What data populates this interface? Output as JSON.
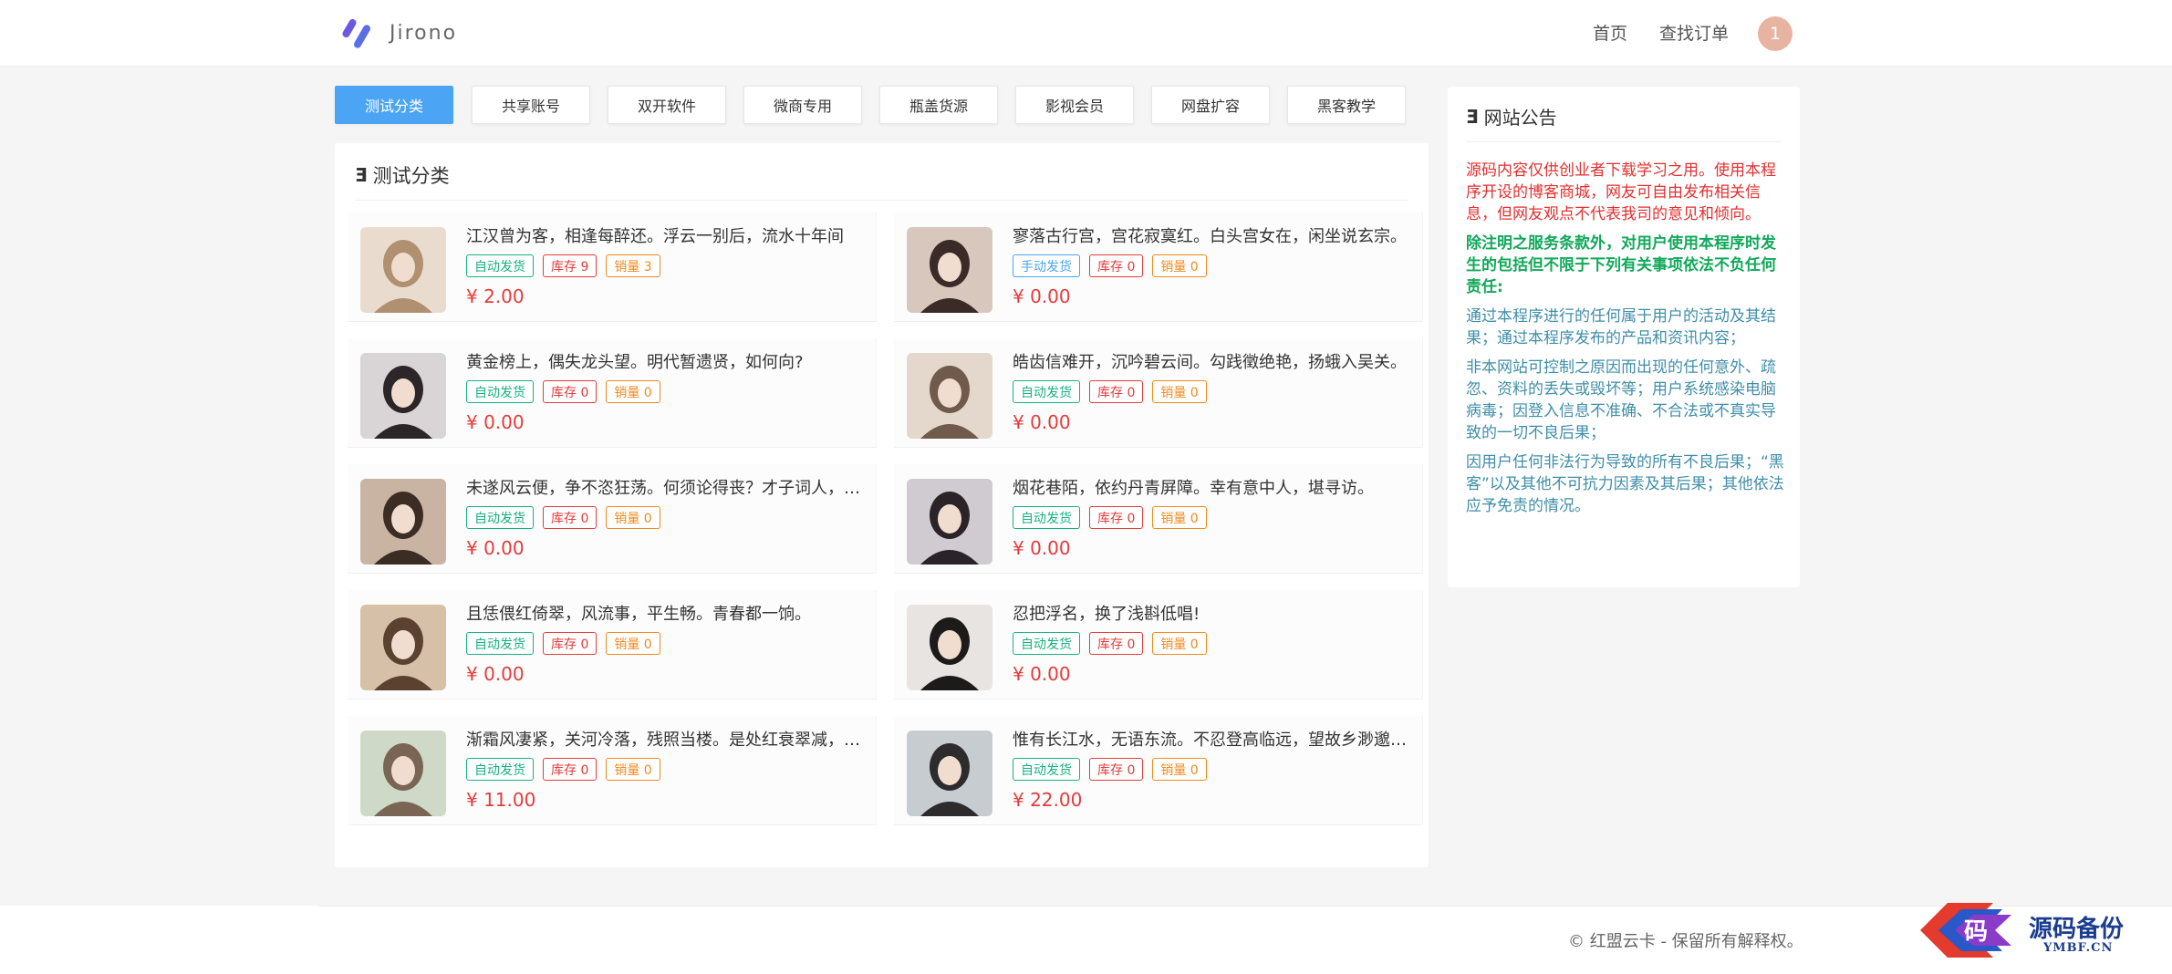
{
  "header": {
    "logo_text": "Jirono",
    "nav": {
      "home": "首页",
      "orders": "查找订单"
    },
    "badge_count": "1"
  },
  "tabs": [
    "测试分类",
    "共享账号",
    "双开软件",
    "微商专用",
    "瓶盖货源",
    "影视会员",
    "网盘扩容",
    "黑客教学"
  ],
  "active_tab": 0,
  "panel": {
    "title": "测试分类",
    "title_icon": "ellipsis-icon"
  },
  "products": [
    {
      "title": "江汉曾为客，相逢每醉还。浮云一别后，流水十年间",
      "delivery": "自动发货",
      "delivery_type": "auto",
      "stock": "库存 9",
      "sales": "销量 3",
      "price": "¥ 2.00"
    },
    {
      "title": "寥落古行宫，宫花寂寞红。白头宫女在，闲坐说玄宗。",
      "delivery": "手动发货",
      "delivery_type": "manual",
      "stock": "库存 0",
      "sales": "销量 0",
      "price": "¥ 0.00"
    },
    {
      "title": "黄金榜上，偶失龙头望。明代暂遗贤，如何向?",
      "delivery": "自动发货",
      "delivery_type": "auto",
      "stock": "库存 0",
      "sales": "销量 0",
      "price": "¥ 0.00"
    },
    {
      "title": "皓齿信难开，沉吟碧云间。勾践徵绝艳，扬蛾入吴关。",
      "delivery": "自动发货",
      "delivery_type": "auto",
      "stock": "库存 0",
      "sales": "销量 0",
      "price": "¥ 0.00"
    },
    {
      "title": "未遂风云便，争不恣狂荡。何须论得丧？才子词人，自是白衣卿相。",
      "delivery": "自动发货",
      "delivery_type": "auto",
      "stock": "库存 0",
      "sales": "销量 0",
      "price": "¥ 0.00"
    },
    {
      "title": "烟花巷陌，依约丹青屏障。幸有意中人，堪寻访。",
      "delivery": "自动发货",
      "delivery_type": "auto",
      "stock": "库存 0",
      "sales": "销量 0",
      "price": "¥ 0.00"
    },
    {
      "title": "且恁偎红倚翠，风流事，平生畅。青春都一饷。",
      "delivery": "自动发货",
      "delivery_type": "auto",
      "stock": "库存 0",
      "sales": "销量 0",
      "price": "¥ 0.00"
    },
    {
      "title": "忍把浮名，换了浅斟低唱!",
      "delivery": "自动发货",
      "delivery_type": "auto",
      "stock": "库存 0",
      "sales": "销量 0",
      "price": "¥ 0.00"
    },
    {
      "title": "渐霜风凄紧，关河冷落，残照当楼。是处红衰翠减，苒苒物华休。",
      "delivery": "自动发货",
      "delivery_type": "auto",
      "stock": "库存 0",
      "sales": "销量 0",
      "price": "¥ 11.00"
    },
    {
      "title": "惟有长江水，无语东流。不忍登高临远，望故乡渺邈，归思难收。",
      "delivery": "自动发货",
      "delivery_type": "auto",
      "stock": "库存 0",
      "sales": "销量 0",
      "price": "¥ 22.00"
    }
  ],
  "notice": {
    "title": "网站公告",
    "p1": "源码内容仅供创业者下载学习之用。使用本程序开设的博客商城，网友可自由发布相关信息，但网友观点不代表我司的意见和倾向。",
    "p2": "除注明之服务条款外，对用户使用本程序时发生的包括但不限于下列有关事项依法不负任何责任:",
    "p3": "通过本程序进行的任何属于用户的活动及其结果；通过本程序发布的产品和资讯内容；",
    "p4": "非本网站可控制之原因而出现的任何意外、疏忽、资料的丢失或毁坏等；用户系统感染电脑病毒；因登入信息不准确、不合法或不真实导致的一切不良后果；",
    "p5": "因用户任何非法行为导致的所有不良后果；“黑客”以及其他不可抗力因素及其后果；其他依法应予免责的情况。"
  },
  "footer": {
    "copyright": "© 红盟云卡 - 保留所有解释权。"
  },
  "watermark": {
    "text": "源码备份",
    "sub": "YMBF.CN",
    "glyph": "码"
  },
  "colors": {
    "accent": "#4ca4f4",
    "price": "#e63b3b",
    "auto": "#16b27c",
    "sales": "#f08a1c"
  }
}
